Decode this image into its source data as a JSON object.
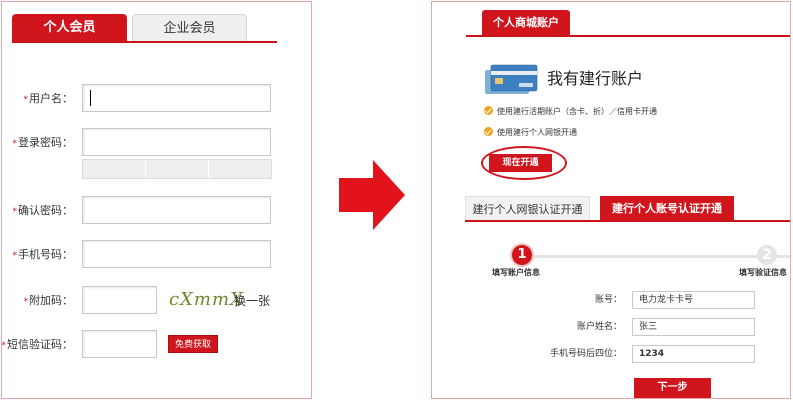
{
  "left": {
    "tabs": [
      "个人会员",
      "企业会员"
    ],
    "fields": {
      "username": {
        "label": "用户名："
      },
      "password": {
        "label": "登录密码："
      },
      "confirm": {
        "label": "确认密码："
      },
      "phone": {
        "label": "手机号码："
      },
      "extra": {
        "label": "附加码："
      },
      "sms": {
        "label": "短信验证码："
      }
    },
    "required_mark": "*",
    "captcha_text": "cXmmX",
    "refresh_label": "换一张",
    "free_button": "免费获取"
  },
  "right": {
    "tab": "个人商城账户",
    "title": "我有建行账户",
    "bullets": [
      "使用建行活期账户（含卡、折）／信用卡开通",
      "使用建行个人网银开通"
    ],
    "open_button": "现在开通",
    "tabs2": [
      "建行个人网银认证开通",
      "建行个人账号认证开通"
    ],
    "steps": [
      {
        "number": "1",
        "label": "填写账户信息"
      },
      {
        "number": "2",
        "label": "填写验证信息"
      }
    ],
    "fields": [
      {
        "label": "账号：",
        "value": "电力龙卡卡号"
      },
      {
        "label": "账户姓名：",
        "value": "张三"
      },
      {
        "label": "手机号码后四位：",
        "value": "1234"
      }
    ],
    "next_button": "下一步"
  },
  "colors": {
    "brand_red": "#d0161c",
    "border_pink": "#e8a8a8",
    "check_orange": "#f0a31c"
  }
}
